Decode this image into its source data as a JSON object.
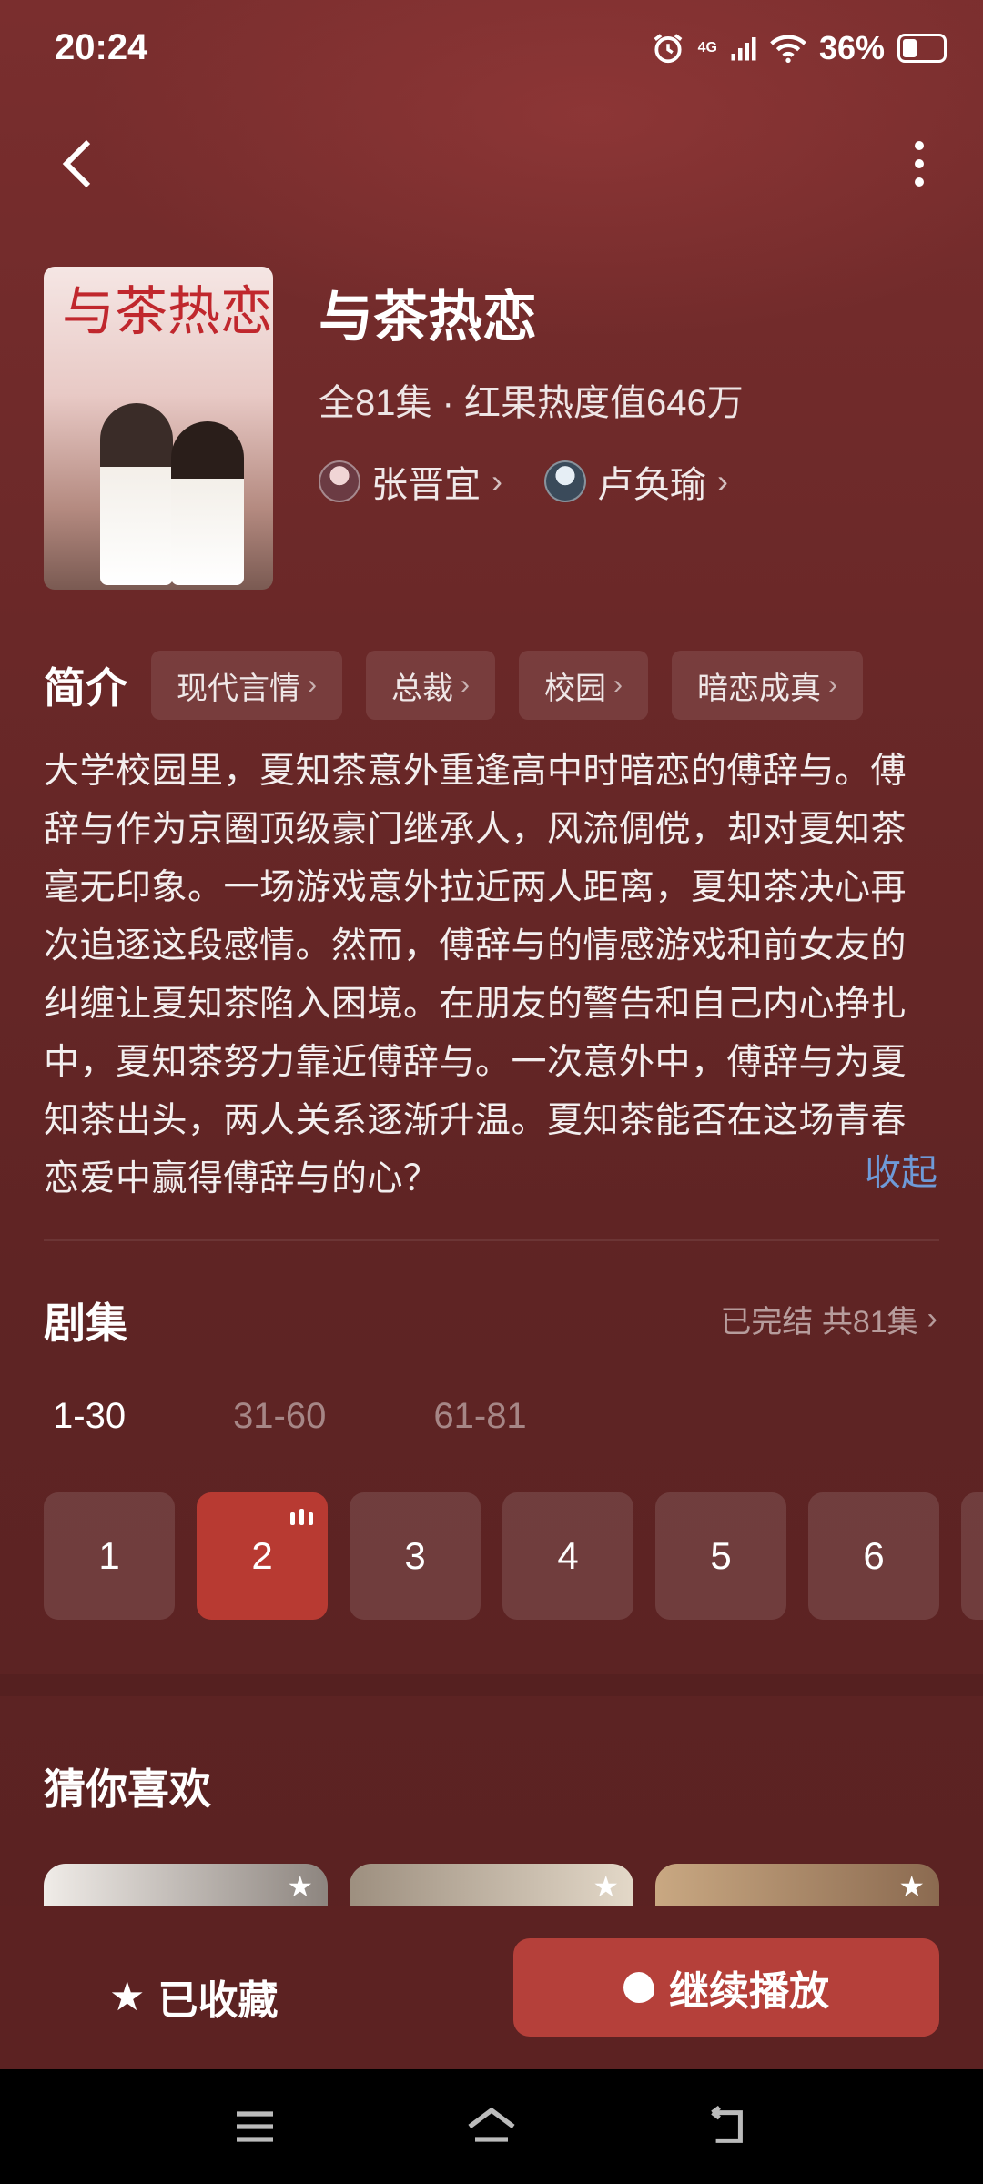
{
  "status_bar": {
    "time": "20:24",
    "network": "4G",
    "battery_text": "36%",
    "battery_level": 0.36
  },
  "top_nav": {
    "back_icon": "chevron-left-icon",
    "more_icon": "more-vertical-icon"
  },
  "drama": {
    "title": "与茶热恋",
    "poster_text": "与茶热恋",
    "meta": "全81集 · 红果热度值646万",
    "actors": [
      {
        "name": "张晋宜"
      },
      {
        "name": "卢奂瑜"
      }
    ]
  },
  "intro": {
    "label": "简介",
    "tags": [
      "现代言情",
      "总裁",
      "校园",
      "暗恋成真"
    ],
    "synopsis": "大学校园里，夏知茶意外重逢高中时暗恋的傅辞与。傅辞与作为京圈顶级豪门继承人，风流倜傥，却对夏知茶毫无印象。一场游戏意外拉近两人距离，夏知茶决心再次追逐这段感情。然而，傅辞与的情感游戏和前女友的纠缠让夏知茶陷入困境。在朋友的警告和自己内心挣扎中，夏知茶努力靠近傅辞与。一次意外中，傅辞与为夏知茶出头，两人关系逐渐升温。夏知茶能否在这场青春恋爱中赢得傅辞与的心？",
    "collapse_label": "收起"
  },
  "episodes": {
    "title": "剧集",
    "status": "已完结 共81集",
    "ranges": [
      "1-30",
      "31-60",
      "61-81"
    ],
    "active_range": 0,
    "items": [
      "1",
      "2",
      "3",
      "4",
      "5",
      "6"
    ],
    "current": "2"
  },
  "recommend": {
    "title": "猜你喜欢"
  },
  "actions": {
    "collect_label": "已收藏",
    "play_label": "继续播放"
  },
  "colors": {
    "background": "#5e2222",
    "accent": "#b5403a",
    "link": "#6e9ad8"
  }
}
